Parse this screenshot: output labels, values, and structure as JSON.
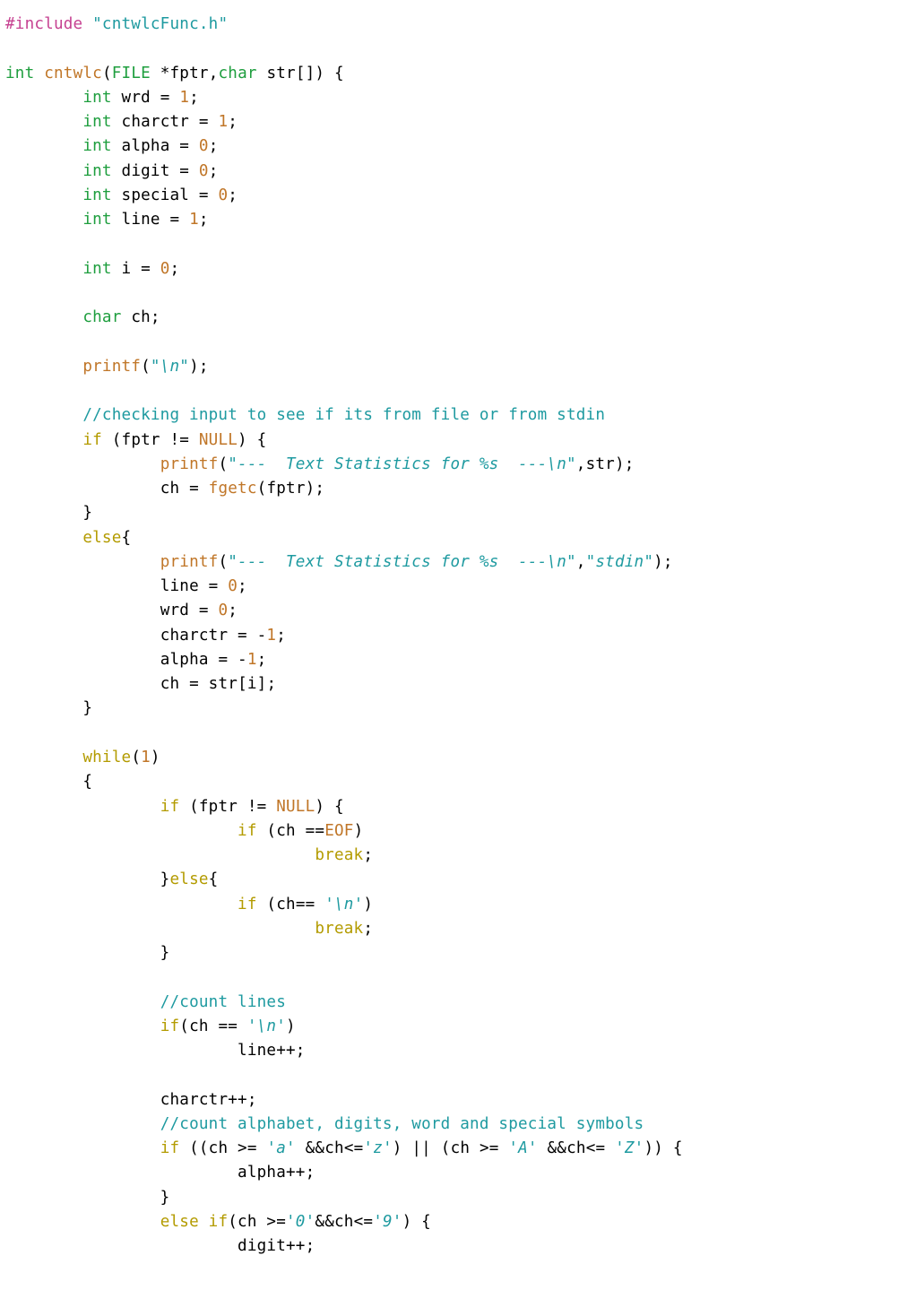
{
  "code_lines": [
    [
      {
        "c": "c-preproc",
        "t": "#include"
      },
      {
        "c": "c-punct",
        "t": " "
      },
      {
        "c": "c-include-str",
        "t": "\"cntwlcFunc.h\""
      }
    ],
    [],
    [
      {
        "c": "c-type",
        "t": "int"
      },
      {
        "c": "c-punct",
        "t": " "
      },
      {
        "c": "c-func",
        "t": "cntwlc"
      },
      {
        "c": "c-punct",
        "t": "("
      },
      {
        "c": "c-type",
        "t": "FILE"
      },
      {
        "c": "c-punct",
        "t": " *"
      },
      {
        "c": "c-ident",
        "t": "fptr"
      },
      {
        "c": "c-punct",
        "t": ","
      },
      {
        "c": "c-type",
        "t": "char"
      },
      {
        "c": "c-punct",
        "t": " "
      },
      {
        "c": "c-ident",
        "t": "str"
      },
      {
        "c": "c-punct",
        "t": "[]) {"
      }
    ],
    [
      {
        "c": "c-punct",
        "t": "        "
      },
      {
        "c": "c-type",
        "t": "int"
      },
      {
        "c": "c-punct",
        "t": " "
      },
      {
        "c": "c-ident",
        "t": "wrd"
      },
      {
        "c": "c-punct",
        "t": " = "
      },
      {
        "c": "c-num",
        "t": "1"
      },
      {
        "c": "c-punct",
        "t": ";"
      }
    ],
    [
      {
        "c": "c-punct",
        "t": "        "
      },
      {
        "c": "c-type",
        "t": "int"
      },
      {
        "c": "c-punct",
        "t": " "
      },
      {
        "c": "c-ident",
        "t": "charctr"
      },
      {
        "c": "c-punct",
        "t": " = "
      },
      {
        "c": "c-num",
        "t": "1"
      },
      {
        "c": "c-punct",
        "t": ";"
      }
    ],
    [
      {
        "c": "c-punct",
        "t": "        "
      },
      {
        "c": "c-type",
        "t": "int"
      },
      {
        "c": "c-punct",
        "t": " "
      },
      {
        "c": "c-ident",
        "t": "alpha"
      },
      {
        "c": "c-punct",
        "t": " = "
      },
      {
        "c": "c-num",
        "t": "0"
      },
      {
        "c": "c-punct",
        "t": ";"
      }
    ],
    [
      {
        "c": "c-punct",
        "t": "        "
      },
      {
        "c": "c-type",
        "t": "int"
      },
      {
        "c": "c-punct",
        "t": " "
      },
      {
        "c": "c-ident",
        "t": "digit"
      },
      {
        "c": "c-punct",
        "t": " = "
      },
      {
        "c": "c-num",
        "t": "0"
      },
      {
        "c": "c-punct",
        "t": ";"
      }
    ],
    [
      {
        "c": "c-punct",
        "t": "        "
      },
      {
        "c": "c-type",
        "t": "int"
      },
      {
        "c": "c-punct",
        "t": " "
      },
      {
        "c": "c-ident",
        "t": "special"
      },
      {
        "c": "c-punct",
        "t": " = "
      },
      {
        "c": "c-num",
        "t": "0"
      },
      {
        "c": "c-punct",
        "t": ";"
      }
    ],
    [
      {
        "c": "c-punct",
        "t": "        "
      },
      {
        "c": "c-type",
        "t": "int"
      },
      {
        "c": "c-punct",
        "t": " "
      },
      {
        "c": "c-ident",
        "t": "line"
      },
      {
        "c": "c-punct",
        "t": " = "
      },
      {
        "c": "c-num",
        "t": "1"
      },
      {
        "c": "c-punct",
        "t": ";"
      }
    ],
    [],
    [
      {
        "c": "c-punct",
        "t": "        "
      },
      {
        "c": "c-type",
        "t": "int"
      },
      {
        "c": "c-punct",
        "t": " "
      },
      {
        "c": "c-ident",
        "t": "i"
      },
      {
        "c": "c-punct",
        "t": " = "
      },
      {
        "c": "c-num",
        "t": "0"
      },
      {
        "c": "c-punct",
        "t": ";"
      }
    ],
    [],
    [
      {
        "c": "c-punct",
        "t": "        "
      },
      {
        "c": "c-type",
        "t": "char"
      },
      {
        "c": "c-punct",
        "t": " "
      },
      {
        "c": "c-ident",
        "t": "ch"
      },
      {
        "c": "c-punct",
        "t": ";"
      }
    ],
    [],
    [
      {
        "c": "c-punct",
        "t": "        "
      },
      {
        "c": "c-func",
        "t": "printf"
      },
      {
        "c": "c-punct",
        "t": "("
      },
      {
        "c": "c-str",
        "t": "\"\\n\""
      },
      {
        "c": "c-punct",
        "t": ");"
      }
    ],
    [],
    [
      {
        "c": "c-punct",
        "t": "        "
      },
      {
        "c": "c-comment",
        "t": "//checking input to see if its from file or from stdin"
      }
    ],
    [
      {
        "c": "c-punct",
        "t": "        "
      },
      {
        "c": "c-kw",
        "t": "if"
      },
      {
        "c": "c-punct",
        "t": " ("
      },
      {
        "c": "c-ident",
        "t": "fptr"
      },
      {
        "c": "c-punct",
        "t": " != "
      },
      {
        "c": "c-null",
        "t": "NULL"
      },
      {
        "c": "c-punct",
        "t": ") {"
      }
    ],
    [
      {
        "c": "c-punct",
        "t": "                "
      },
      {
        "c": "c-func",
        "t": "printf"
      },
      {
        "c": "c-punct",
        "t": "("
      },
      {
        "c": "c-str",
        "t": "\"---  Text Statistics for %s  ---\\n\""
      },
      {
        "c": "c-punct",
        "t": ","
      },
      {
        "c": "c-ident",
        "t": "str"
      },
      {
        "c": "c-punct",
        "t": ");"
      }
    ],
    [
      {
        "c": "c-punct",
        "t": "                "
      },
      {
        "c": "c-ident",
        "t": "ch"
      },
      {
        "c": "c-punct",
        "t": " = "
      },
      {
        "c": "c-func",
        "t": "fgetc"
      },
      {
        "c": "c-punct",
        "t": "("
      },
      {
        "c": "c-ident",
        "t": "fptr"
      },
      {
        "c": "c-punct",
        "t": ");"
      }
    ],
    [
      {
        "c": "c-punct",
        "t": "        }"
      }
    ],
    [
      {
        "c": "c-punct",
        "t": "        "
      },
      {
        "c": "c-kw",
        "t": "else"
      },
      {
        "c": "c-punct",
        "t": "{"
      }
    ],
    [
      {
        "c": "c-punct",
        "t": "                "
      },
      {
        "c": "c-func",
        "t": "printf"
      },
      {
        "c": "c-punct",
        "t": "("
      },
      {
        "c": "c-str",
        "t": "\"---  Text Statistics for %s  ---\\n\""
      },
      {
        "c": "c-punct",
        "t": ","
      },
      {
        "c": "c-str",
        "t": "\"stdin\""
      },
      {
        "c": "c-punct",
        "t": ");"
      }
    ],
    [
      {
        "c": "c-punct",
        "t": "                "
      },
      {
        "c": "c-ident",
        "t": "line"
      },
      {
        "c": "c-punct",
        "t": " = "
      },
      {
        "c": "c-num",
        "t": "0"
      },
      {
        "c": "c-punct",
        "t": ";"
      }
    ],
    [
      {
        "c": "c-punct",
        "t": "                "
      },
      {
        "c": "c-ident",
        "t": "wrd"
      },
      {
        "c": "c-punct",
        "t": " = "
      },
      {
        "c": "c-num",
        "t": "0"
      },
      {
        "c": "c-punct",
        "t": ";"
      }
    ],
    [
      {
        "c": "c-punct",
        "t": "                "
      },
      {
        "c": "c-ident",
        "t": "charctr"
      },
      {
        "c": "c-punct",
        "t": " = -"
      },
      {
        "c": "c-num",
        "t": "1"
      },
      {
        "c": "c-punct",
        "t": ";"
      }
    ],
    [
      {
        "c": "c-punct",
        "t": "                "
      },
      {
        "c": "c-ident",
        "t": "alpha"
      },
      {
        "c": "c-punct",
        "t": " = -"
      },
      {
        "c": "c-num",
        "t": "1"
      },
      {
        "c": "c-punct",
        "t": ";"
      }
    ],
    [
      {
        "c": "c-punct",
        "t": "                "
      },
      {
        "c": "c-ident",
        "t": "ch"
      },
      {
        "c": "c-punct",
        "t": " = "
      },
      {
        "c": "c-ident",
        "t": "str"
      },
      {
        "c": "c-punct",
        "t": "["
      },
      {
        "c": "c-ident",
        "t": "i"
      },
      {
        "c": "c-punct",
        "t": "];"
      }
    ],
    [
      {
        "c": "c-punct",
        "t": "        }"
      }
    ],
    [],
    [
      {
        "c": "c-punct",
        "t": "        "
      },
      {
        "c": "c-kw",
        "t": "while"
      },
      {
        "c": "c-punct",
        "t": "("
      },
      {
        "c": "c-num",
        "t": "1"
      },
      {
        "c": "c-punct",
        "t": ")"
      }
    ],
    [
      {
        "c": "c-punct",
        "t": "        {"
      }
    ],
    [
      {
        "c": "c-punct",
        "t": "                "
      },
      {
        "c": "c-kw",
        "t": "if"
      },
      {
        "c": "c-punct",
        "t": " ("
      },
      {
        "c": "c-ident",
        "t": "fptr"
      },
      {
        "c": "c-punct",
        "t": " != "
      },
      {
        "c": "c-null",
        "t": "NULL"
      },
      {
        "c": "c-punct",
        "t": ") {"
      }
    ],
    [
      {
        "c": "c-punct",
        "t": "                        "
      },
      {
        "c": "c-kw",
        "t": "if"
      },
      {
        "c": "c-punct",
        "t": " ("
      },
      {
        "c": "c-ident",
        "t": "ch"
      },
      {
        "c": "c-punct",
        "t": " =="
      },
      {
        "c": "c-null",
        "t": "EOF"
      },
      {
        "c": "c-punct",
        "t": ")"
      }
    ],
    [
      {
        "c": "c-punct",
        "t": "                                "
      },
      {
        "c": "c-kw",
        "t": "break"
      },
      {
        "c": "c-punct",
        "t": ";"
      }
    ],
    [
      {
        "c": "c-punct",
        "t": "                }"
      },
      {
        "c": "c-kw",
        "t": "else"
      },
      {
        "c": "c-punct",
        "t": "{"
      }
    ],
    [
      {
        "c": "c-punct",
        "t": "                        "
      },
      {
        "c": "c-kw",
        "t": "if"
      },
      {
        "c": "c-punct",
        "t": " ("
      },
      {
        "c": "c-ident",
        "t": "ch"
      },
      {
        "c": "c-punct",
        "t": "== "
      },
      {
        "c": "c-ch",
        "t": "'\\n'"
      },
      {
        "c": "c-punct",
        "t": ")"
      }
    ],
    [
      {
        "c": "c-punct",
        "t": "                                "
      },
      {
        "c": "c-kw",
        "t": "break"
      },
      {
        "c": "c-punct",
        "t": ";"
      }
    ],
    [
      {
        "c": "c-punct",
        "t": "                }"
      }
    ],
    [],
    [
      {
        "c": "c-punct",
        "t": "                "
      },
      {
        "c": "c-comment",
        "t": "//count lines"
      }
    ],
    [
      {
        "c": "c-punct",
        "t": "                "
      },
      {
        "c": "c-kw",
        "t": "if"
      },
      {
        "c": "c-punct",
        "t": "("
      },
      {
        "c": "c-ident",
        "t": "ch"
      },
      {
        "c": "c-punct",
        "t": " == "
      },
      {
        "c": "c-ch",
        "t": "'\\n'"
      },
      {
        "c": "c-punct",
        "t": ")"
      }
    ],
    [
      {
        "c": "c-punct",
        "t": "                        "
      },
      {
        "c": "c-ident",
        "t": "line"
      },
      {
        "c": "c-punct",
        "t": "++;"
      }
    ],
    [],
    [
      {
        "c": "c-punct",
        "t": "                "
      },
      {
        "c": "c-ident",
        "t": "charctr"
      },
      {
        "c": "c-punct",
        "t": "++;"
      }
    ],
    [
      {
        "c": "c-punct",
        "t": "                "
      },
      {
        "c": "c-comment",
        "t": "//count alphabet, digits, word and special symbols"
      }
    ],
    [
      {
        "c": "c-punct",
        "t": "                "
      },
      {
        "c": "c-kw",
        "t": "if"
      },
      {
        "c": "c-punct",
        "t": " (("
      },
      {
        "c": "c-ident",
        "t": "ch"
      },
      {
        "c": "c-punct",
        "t": " >= "
      },
      {
        "c": "c-ch",
        "t": "'a'"
      },
      {
        "c": "c-punct",
        "t": " &&"
      },
      {
        "c": "c-ident",
        "t": "ch"
      },
      {
        "c": "c-punct",
        "t": "<="
      },
      {
        "c": "c-ch",
        "t": "'z'"
      },
      {
        "c": "c-punct",
        "t": ") || ("
      },
      {
        "c": "c-ident",
        "t": "ch"
      },
      {
        "c": "c-punct",
        "t": " >= "
      },
      {
        "c": "c-ch",
        "t": "'A'"
      },
      {
        "c": "c-punct",
        "t": " &&"
      },
      {
        "c": "c-ident",
        "t": "ch"
      },
      {
        "c": "c-punct",
        "t": "<= "
      },
      {
        "c": "c-ch",
        "t": "'Z'"
      },
      {
        "c": "c-punct",
        "t": ")) {"
      }
    ],
    [
      {
        "c": "c-punct",
        "t": "                        "
      },
      {
        "c": "c-ident",
        "t": "alpha"
      },
      {
        "c": "c-punct",
        "t": "++;"
      }
    ],
    [
      {
        "c": "c-punct",
        "t": "                }"
      }
    ],
    [
      {
        "c": "c-punct",
        "t": "                "
      },
      {
        "c": "c-kw",
        "t": "else if"
      },
      {
        "c": "c-punct",
        "t": "("
      },
      {
        "c": "c-ident",
        "t": "ch"
      },
      {
        "c": "c-punct",
        "t": " >="
      },
      {
        "c": "c-ch",
        "t": "'0'"
      },
      {
        "c": "c-punct",
        "t": "&&"
      },
      {
        "c": "c-ident",
        "t": "ch"
      },
      {
        "c": "c-punct",
        "t": "<="
      },
      {
        "c": "c-ch",
        "t": "'9'"
      },
      {
        "c": "c-punct",
        "t": ") {"
      }
    ],
    [
      {
        "c": "c-punct",
        "t": "                        "
      },
      {
        "c": "c-ident",
        "t": "digit"
      },
      {
        "c": "c-punct",
        "t": "++;"
      }
    ]
  ]
}
